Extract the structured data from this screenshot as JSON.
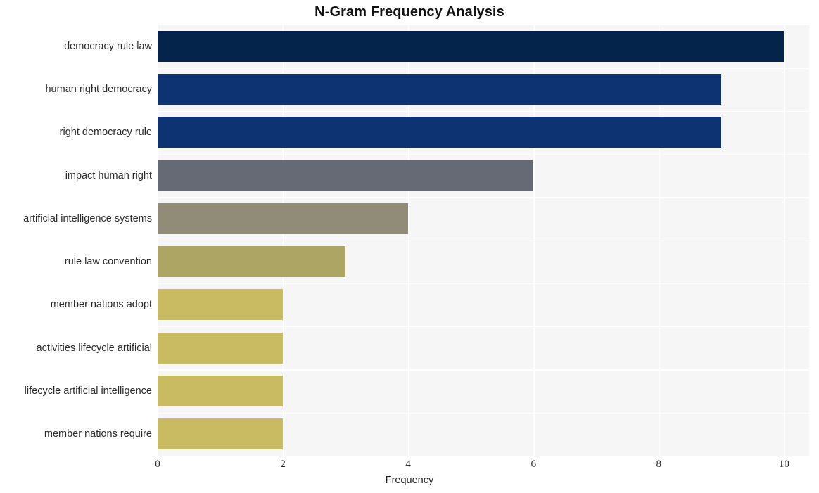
{
  "chart_data": {
    "type": "bar",
    "orientation": "horizontal",
    "title": "N-Gram Frequency Analysis",
    "xlabel": "Frequency",
    "ylabel": "",
    "categories": [
      "democracy rule law",
      "human right democracy",
      "right democracy rule",
      "impact human right",
      "artificial intelligence systems",
      "rule law convention",
      "member nations adopt",
      "activities lifecycle artificial",
      "lifecycle artificial intelligence",
      "member nations require"
    ],
    "values": [
      10,
      9,
      9,
      6,
      4,
      3,
      2,
      2,
      2,
      2
    ],
    "bar_colors": [
      "#05244c",
      "#0d3372",
      "#0d3372",
      "#656a75",
      "#918c77",
      "#ada563",
      "#c9bb62",
      "#c9bb62",
      "#c9bb62",
      "#c9bb62"
    ],
    "xlim": [
      0,
      10.4
    ],
    "xticks": [
      0,
      2,
      4,
      6,
      8,
      10
    ],
    "xtick_labels": [
      "0",
      "2",
      "4",
      "6",
      "8",
      "10"
    ],
    "grid": true,
    "grid_color": "#ffffff",
    "plot_background": "#f6f6f7",
    "figure_background": "#ffffff",
    "legend": null
  }
}
